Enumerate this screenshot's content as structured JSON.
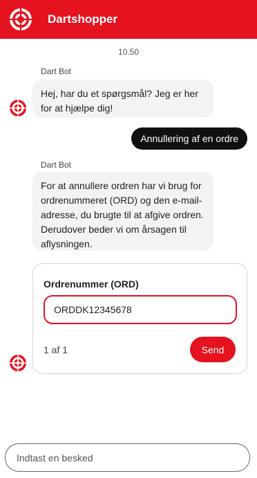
{
  "header": {
    "brand_icon": "dartshopper-target-logo",
    "title": "Dartshopper",
    "color": "#e5121f"
  },
  "chat": {
    "timestamp": "10.50",
    "messages": [
      {
        "sender": "Dart Bot",
        "text": "Hej, har du et spørgsmål? Jeg er her for at hjælpe dig!"
      },
      {
        "sender": "user",
        "text": "Annullering af en ordre"
      },
      {
        "sender": "Dart Bot",
        "text": "For at annullere ordren har vi brug for ordrenummeret (ORD) og den e-mail-adresse, du brugte til at afgive ordren. Derudover beder vi om årsagen til aflysningen."
      }
    ],
    "bot_avatar_icon": "dartshopper-target-icon"
  },
  "form": {
    "label": "Ordrenummer (ORD)",
    "value": "ORDDK12345678",
    "pager": "1 af 1",
    "send_label": "Send"
  },
  "composer": {
    "placeholder": "Indtast en besked"
  }
}
